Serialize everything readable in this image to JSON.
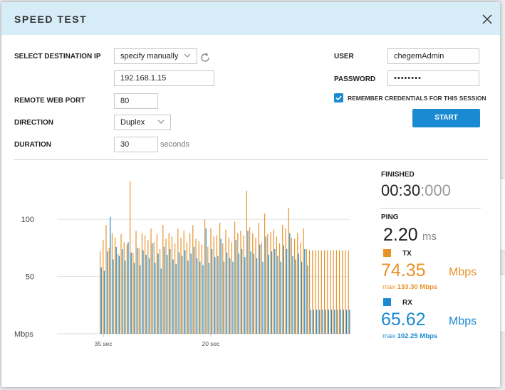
{
  "dialog": {
    "title": "SPEED TEST",
    "destination_label": "SELECT DESTINATION IP",
    "destination_mode": "specify manually",
    "destination_ip": "192.168.1.15",
    "port_label": "REMOTE WEB PORT",
    "port_value": "80",
    "direction_label": "DIRECTION",
    "direction_value": "Duplex",
    "duration_label": "DURATION",
    "duration_value": "30",
    "duration_unit": "seconds",
    "user_label": "USER",
    "user_value": "chegemAdmin",
    "password_label": "PASSWORD",
    "password_value": "••••••••",
    "remember_label": "REMEMBER CREDENTIALS FOR THIS SESSION",
    "start_label": "START"
  },
  "stats": {
    "status_label": "FINISHED",
    "timer_main": "00:30",
    "timer_ms": ":000",
    "ping_label": "PING",
    "ping_value": "2.20",
    "ping_unit": "ms",
    "tx_label": "TX",
    "tx_value": "74.35",
    "tx_unit": "Mbps",
    "tx_max_prefix": "max",
    "tx_max": "133.30 Mbps",
    "rx_label": "RX",
    "rx_value": "65.62",
    "rx_unit": "Mbps",
    "rx_max_prefix": "max",
    "rx_max": "102.25 Mbps"
  },
  "colors": {
    "tx": "#e8922a",
    "rx": "#1a8ad3",
    "accent": "#1a8ad3",
    "header_bg": "#d6ecf7"
  },
  "chart_data": {
    "type": "bar",
    "ylabel": "Mbps",
    "ylim": [
      0,
      130
    ],
    "yticks": [
      50,
      100
    ],
    "ytick_labels": [
      "50",
      "100"
    ],
    "xtick_labels": [
      "35 sec",
      "20 sec"
    ],
    "grid": true,
    "series": [
      {
        "name": "TX",
        "values": [
          72,
          82,
          95,
          75,
          88,
          84,
          70,
          87,
          80,
          78,
          133,
          71,
          90,
          75,
          88,
          86,
          82,
          92,
          80,
          87,
          74,
          95,
          83,
          88,
          85,
          79,
          92,
          84,
          90,
          80,
          88,
          95,
          83,
          81,
          78,
          100,
          76,
          92,
          85,
          86,
          97,
          79,
          91,
          84,
          80,
          98,
          88,
          90,
          86,
          125,
          93,
          88,
          84,
          97,
          80,
          105,
          87,
          89,
          91,
          85,
          79,
          95,
          92,
          110,
          84,
          83,
          88,
          80,
          92,
          74,
          73,
          73,
          73,
          73,
          73,
          73,
          73,
          73,
          73,
          73,
          73,
          73,
          73,
          73,
          73
        ]
      },
      {
        "name": "RX",
        "values": [
          58,
          55,
          72,
          102,
          65,
          76,
          68,
          74,
          64,
          80,
          71,
          62,
          75,
          60,
          73,
          69,
          66,
          79,
          62,
          70,
          57,
          76,
          69,
          74,
          65,
          61,
          71,
          68,
          73,
          64,
          70,
          76,
          66,
          63,
          60,
          92,
          62,
          74,
          67,
          68,
          83,
          63,
          71,
          66,
          63,
          82,
          70,
          74,
          67,
          90,
          72,
          70,
          66,
          78,
          63,
          85,
          69,
          72,
          74,
          68,
          63,
          77,
          74,
          88,
          68,
          65,
          70,
          63,
          74,
          60,
          21,
          21,
          21,
          21,
          21,
          21,
          21,
          21,
          21,
          21,
          21,
          21,
          21,
          21,
          21
        ]
      }
    ]
  }
}
